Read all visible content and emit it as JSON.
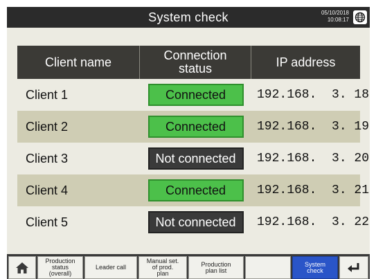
{
  "header": {
    "title": "System check",
    "date": "05/10/2018",
    "time": "10:08:17",
    "globe_icon": "globe-icon"
  },
  "table": {
    "columns": [
      "Client name",
      "Connection\nstatus",
      "IP address"
    ],
    "rows": [
      {
        "client": "Client 1",
        "status": "Connected",
        "ip": "192.168.  3. 18"
      },
      {
        "client": "Client 2",
        "status": "Connected",
        "ip": "192.168.  3. 19"
      },
      {
        "client": "Client 3",
        "status": "Not connected",
        "ip": "192.168.  3. 20"
      },
      {
        "client": "Client 4",
        "status": "Connected",
        "ip": "192.168.  3. 21"
      },
      {
        "client": "Client 5",
        "status": "Not connected",
        "ip": "192.168.  3. 22"
      }
    ]
  },
  "colors": {
    "connected": "#4cc04a",
    "not_connected": "#3a3a3a",
    "active_nav": "#2a55c8",
    "row_alt": "#cfcdb4"
  },
  "footer": {
    "home_icon": "home-icon",
    "production_status": "Production\nstatus\n(overall)",
    "leader_call": "Leader call",
    "manual_set": "Manual set.\nof prod.\nplan",
    "production_plan_list": "Production\nplan list",
    "blank": "",
    "system_check": "System\ncheck",
    "return_icon": "return-icon"
  }
}
